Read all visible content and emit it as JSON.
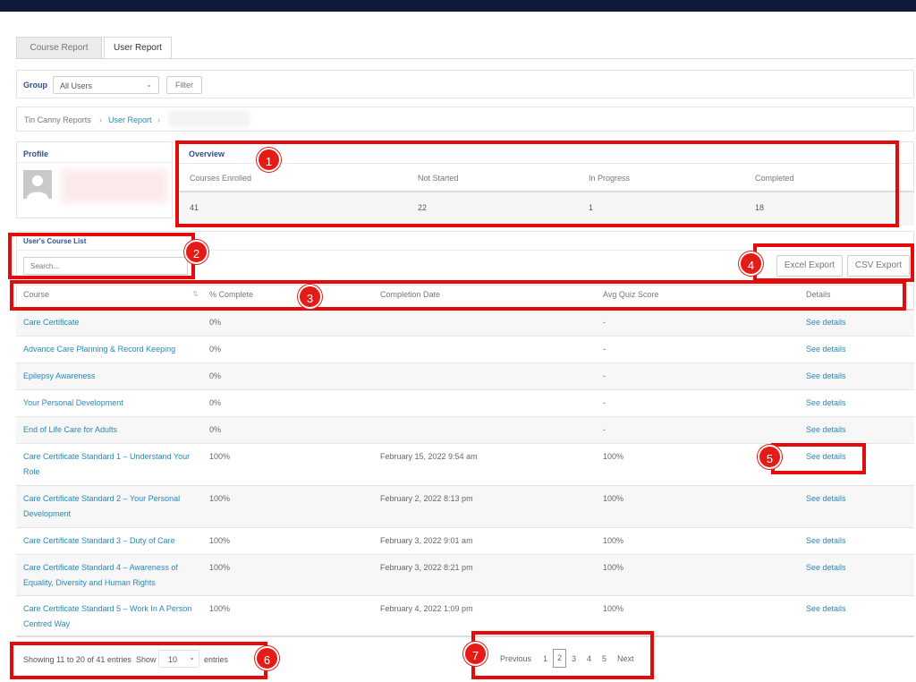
{
  "tabs": [
    {
      "label": "Course Report"
    },
    {
      "label": "User Report"
    }
  ],
  "filter": {
    "group_label": "Group",
    "group_value": "All Users",
    "filter_button": "Filter"
  },
  "breadcrumb": {
    "root": "Tin Canny Reports",
    "current": "User Report",
    "sep": "›"
  },
  "profile": {
    "title": "Profile"
  },
  "overview": {
    "title": "Overview",
    "headers": [
      "Courses Enrolled",
      "Not Started",
      "In Progress",
      "Completed"
    ],
    "values": [
      "41",
      "22",
      "1",
      "18"
    ]
  },
  "course_list": {
    "title": "User's Course List",
    "search_placeholder": "Search...",
    "excel_export": "Excel Export",
    "csv_export": "CSV Export"
  },
  "table": {
    "headers": {
      "course": "Course",
      "pct": "% Complete",
      "date": "Completion Date",
      "quiz": "Avg Quiz Score",
      "details": "Details"
    },
    "rows": [
      {
        "course": "Care Certificate",
        "pct": "0%",
        "date": "",
        "quiz": "-",
        "details": "See details"
      },
      {
        "course": "Advance Care Planning & Record Keeping",
        "pct": "0%",
        "date": "",
        "quiz": "-",
        "details": "See details"
      },
      {
        "course": "Epilepsy Awareness",
        "pct": "0%",
        "date": "",
        "quiz": "-",
        "details": "See details"
      },
      {
        "course": "Your Personal Development",
        "pct": "0%",
        "date": "",
        "quiz": "-",
        "details": "See details"
      },
      {
        "course": "End of Life Care for Adults",
        "pct": "0%",
        "date": "",
        "quiz": "-",
        "details": "See details"
      },
      {
        "course": "Care Certificate Standard 1 – Understand Your Role",
        "pct": "100%",
        "date": "February 15, 2022 9:54 am",
        "quiz": "100%",
        "details": "See details"
      },
      {
        "course": "Care Certificate Standard 2 – Your Personal Development",
        "pct": "100%",
        "date": "February 2, 2022 8:13 pm",
        "quiz": "100%",
        "details": "See details"
      },
      {
        "course": "Care Certificate Standard 3 – Duty of Care",
        "pct": "100%",
        "date": "February 3, 2022 9:01 am",
        "quiz": "100%",
        "details": "See details"
      },
      {
        "course": "Care Certificate Standard 4 – Awareness of Equality, Diversity and Human Rights",
        "pct": "100%",
        "date": "February 3, 2022 8:21 pm",
        "quiz": "100%",
        "details": "See details"
      },
      {
        "course": "Care Certificate Standard 5 – Work In A Person Centred Way",
        "pct": "100%",
        "date": "February 4, 2022 1:09 pm",
        "quiz": "100%",
        "details": "See details"
      }
    ]
  },
  "footer": {
    "showing": "Showing 11 to 20 of 41 entries",
    "show_label": "Show",
    "page_size": "10",
    "entries_label": "entries"
  },
  "pagination": {
    "previous": "Previous",
    "pages": [
      "1",
      "2",
      "3",
      "4",
      "5"
    ],
    "current": "2",
    "next": "Next"
  },
  "annotations": [
    "1",
    "2",
    "3",
    "4",
    "5",
    "6",
    "7"
  ],
  "colors": {
    "accent": "#2a87b8",
    "annotation": "#e60b0b",
    "topbar": "#10193a"
  }
}
